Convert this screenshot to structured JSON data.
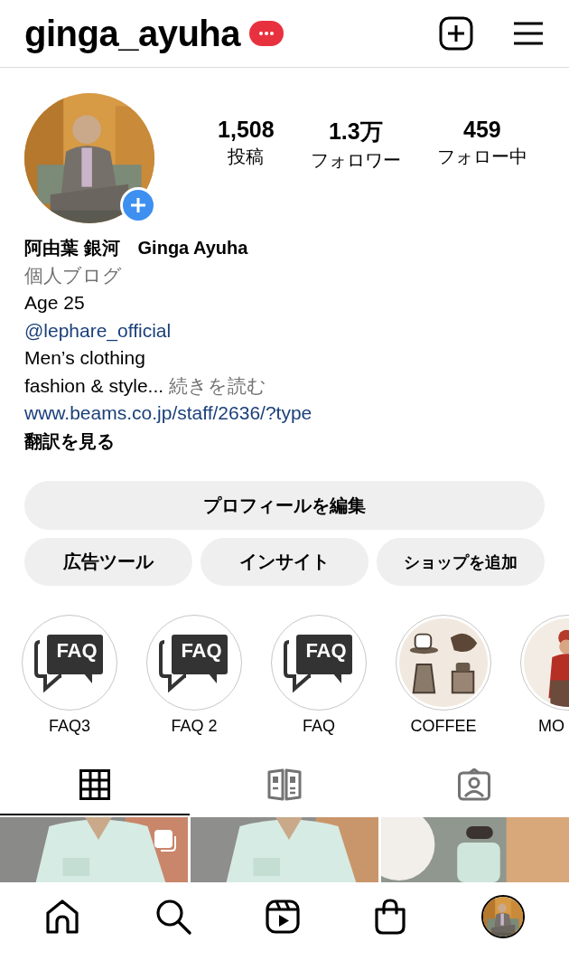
{
  "header": {
    "username": "ginga_ayuha"
  },
  "stats": [
    {
      "value": "1,508",
      "label": "投稿"
    },
    {
      "value": "1.3万",
      "label": "フォロワー"
    },
    {
      "value": "459",
      "label": "フォロー中"
    }
  ],
  "bio": [
    {
      "kind": "name",
      "text": "阿由葉 銀河　Ginga Ayuha"
    },
    {
      "kind": "category",
      "text": "個人ブログ"
    },
    {
      "kind": "text",
      "text": "Age 25"
    },
    {
      "kind": "mention",
      "text": "@lephare_official"
    },
    {
      "kind": "text",
      "text": "Men’s clothing"
    },
    {
      "kind": "more",
      "text": "fashion & style...",
      "more": "続きを読む"
    },
    {
      "kind": "url",
      "text": "www.beams.co.jp/staff/2636/?type"
    },
    {
      "kind": "translate",
      "text": "翻訳を見る"
    }
  ],
  "edit_button": {
    "label": "プロフィールを編集"
  },
  "action_buttons": [
    {
      "label": "広告ツール"
    },
    {
      "label": "インサイト"
    },
    {
      "label": "ショップを追加"
    }
  ],
  "highlights": [
    {
      "kind": "faq",
      "cover_text": "FAQ",
      "label": "FAQ3"
    },
    {
      "kind": "faq",
      "cover_text": "FAQ",
      "label": "FAQ 2"
    },
    {
      "kind": "faq",
      "cover_text": "FAQ",
      "label": "FAQ"
    },
    {
      "kind": "coffee",
      "label": "COFFEE"
    },
    {
      "kind": "picture",
      "label": "MO"
    }
  ],
  "tabs": [
    {
      "kind": "grid",
      "selected": true
    },
    {
      "kind": "guide",
      "selected": false
    },
    {
      "kind": "tagged",
      "selected": false
    }
  ],
  "posts": [
    {
      "kind": "picture",
      "multiple": true
    },
    {
      "kind": "picture",
      "multiple": false
    },
    {
      "kind": "picture",
      "multiple": false
    }
  ],
  "nav": [
    {
      "kind": "home"
    },
    {
      "kind": "search"
    },
    {
      "kind": "reels"
    },
    {
      "kind": "shop"
    },
    {
      "kind": "profile"
    }
  ]
}
